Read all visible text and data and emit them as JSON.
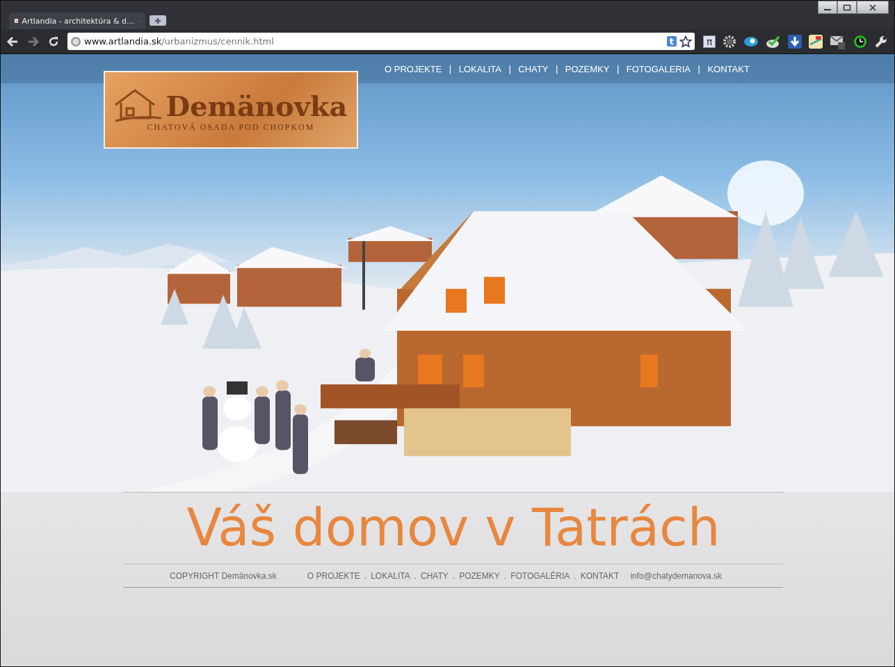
{
  "window": {
    "tab_title": "Artlandia - architektúra & d…"
  },
  "toolbar": {
    "url_host": "www.artlandia.sk",
    "url_path": "/urbanizmus/cennik.html",
    "addressbar_badge": "t",
    "extension_letter": "π"
  },
  "page": {
    "logo": {
      "name": "Demänovka",
      "tagline": "CHATOVÁ OSADA POD CHOPKOM"
    },
    "nav": {
      "separator": "|",
      "items": [
        "O PROJEKTE",
        "LOKALITA",
        "CHATY",
        "POZEMKY",
        "FOTOGALERIA",
        "KONTAKT"
      ]
    },
    "headline": "Váš domov v Tatrách",
    "footer": {
      "copyright": "COPYRIGHT Demänovka.sk",
      "separator": ".",
      "links": [
        "O PROJEKTE",
        "LOKALITA",
        "CHATY",
        "POZEMKY",
        "FOTOGALÉRIA",
        "KONTAKT"
      ],
      "email": "info@chatydemanova.sk"
    }
  }
}
